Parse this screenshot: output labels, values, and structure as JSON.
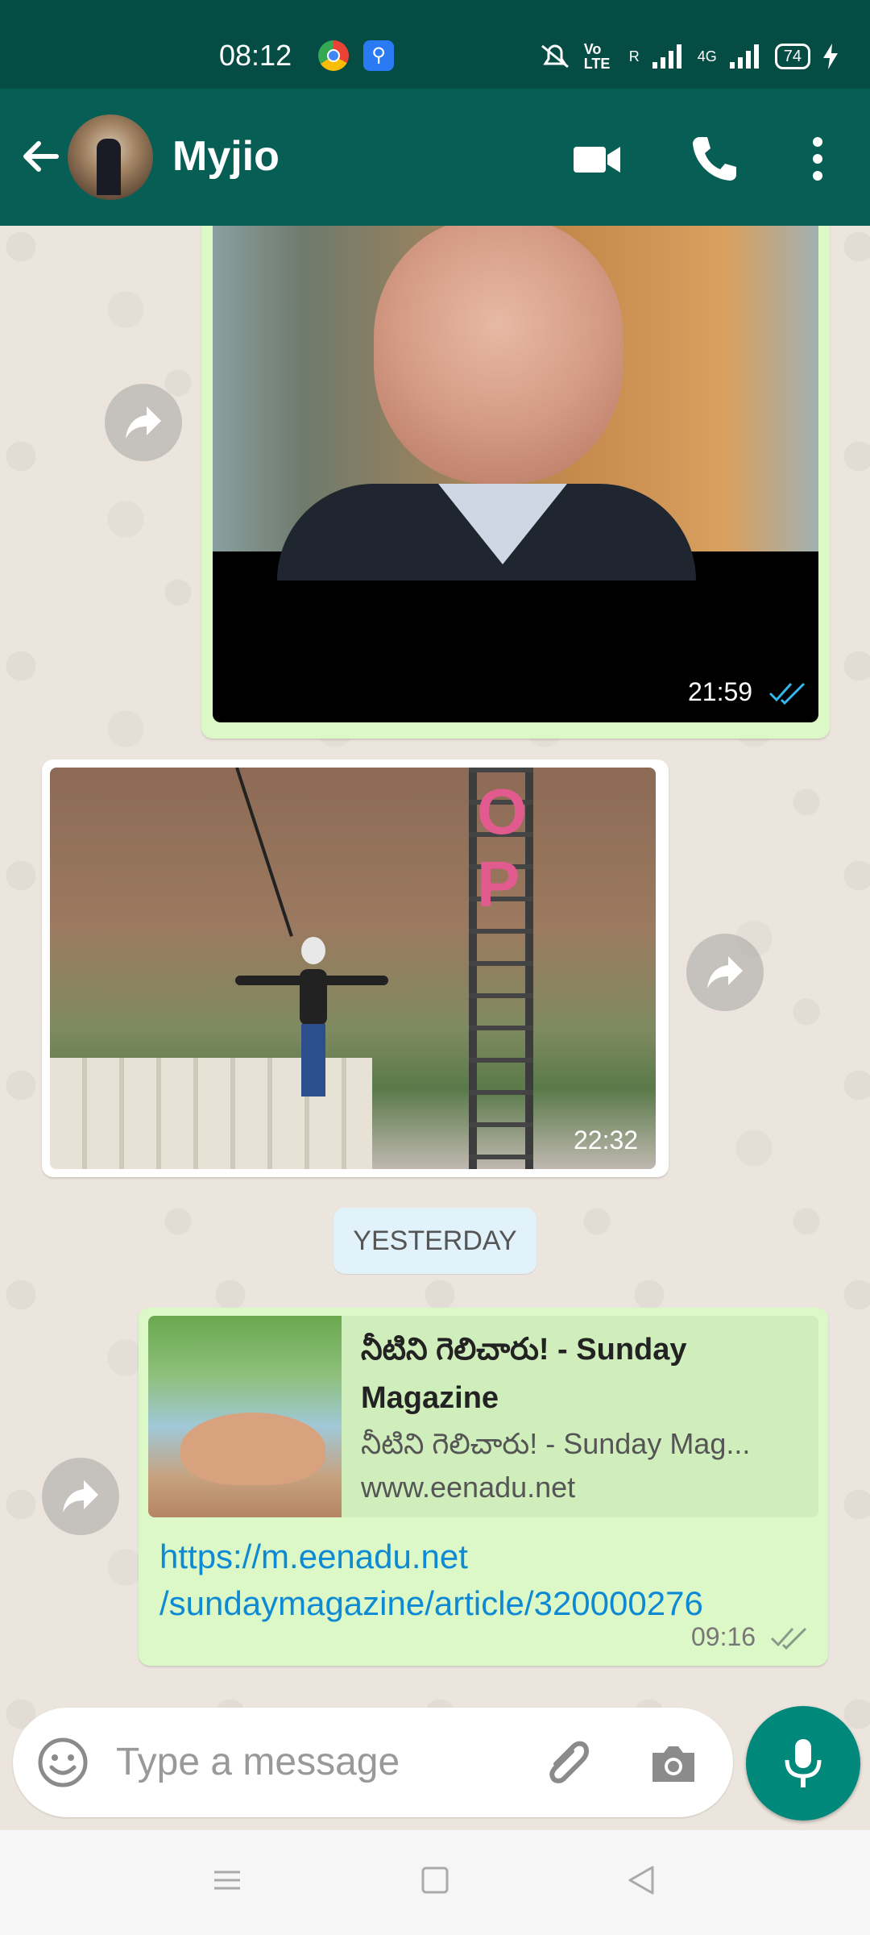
{
  "status_bar": {
    "time": "08:12",
    "network_labels": [
      "Vo LTE",
      "R",
      "4G"
    ],
    "battery": "74"
  },
  "header": {
    "contact_name": "Myjio",
    "icons": [
      "back-arrow-icon",
      "video-call-icon",
      "voice-call-icon",
      "more-options-icon"
    ]
  },
  "messages": [
    {
      "type": "image",
      "direction": "outgoing",
      "time": "21:59",
      "status": "read"
    },
    {
      "type": "image",
      "direction": "incoming",
      "time": "22:32"
    },
    {
      "type": "date-separator",
      "label": "YESTERDAY"
    },
    {
      "type": "link",
      "direction": "outgoing",
      "preview_title": "నీటిని గెలిచారు! - Sunday Magazine",
      "preview_description": "నీటిని గెలిచారు! - Sunday Mag...",
      "preview_domain": "www.eenadu.net",
      "url": "https://m.eenadu.net /sundaymagazine/article/320000276",
      "time": "09:16",
      "status": "delivered"
    }
  ],
  "photo_text": {
    "letters": "OP"
  },
  "composer": {
    "placeholder": "Type a message"
  },
  "colors": {
    "header": "#075e54",
    "status_bar": "#054d44",
    "outgoing_bubble": "#dcf8c6",
    "incoming_bubble": "#ffffff",
    "link": "#0e8ad4",
    "read_tick": "#34b7f1",
    "mic_button": "#00897b"
  }
}
